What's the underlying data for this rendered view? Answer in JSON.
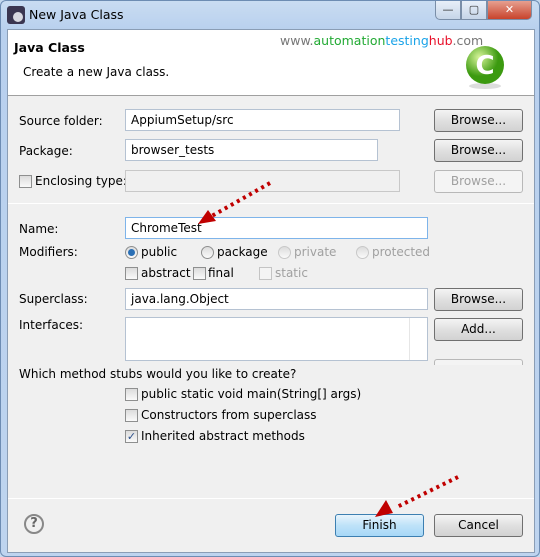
{
  "window": {
    "title": "New Java Class",
    "minimize": "—",
    "maximize": "▢",
    "close": "✕"
  },
  "header": {
    "title": "Java Class",
    "description": "Create a new Java class.",
    "watermark": {
      "www": "www.",
      "a": "automation",
      "b": "testing",
      "c": "hub",
      "d": ".com"
    },
    "logo_letter": "C"
  },
  "form": {
    "source_folder": {
      "label": "Source folder:",
      "value": "AppiumSetup/src",
      "button": "Browse..."
    },
    "package": {
      "label": "Package:",
      "value": "browser_tests",
      "button": "Browse..."
    },
    "enclosing_type": {
      "label": "Enclosing type:",
      "checked": false,
      "value": "",
      "button": "Browse..."
    },
    "name": {
      "label": "Name:",
      "value": "ChromeTest"
    },
    "modifiers": {
      "label": "Modifiers:",
      "options": [
        "public",
        "package",
        "private",
        "protected"
      ],
      "selected": "public",
      "checks": [
        "abstract",
        "final",
        "static"
      ]
    },
    "superclass": {
      "label": "Superclass:",
      "value": "java.lang.Object",
      "button": "Browse..."
    },
    "interfaces": {
      "label": "Interfaces:",
      "add_button": "Add..."
    },
    "stubs": {
      "question": "Which method stubs would you like to create?",
      "items": [
        {
          "label": "public static void main(String[] args)",
          "checked": false
        },
        {
          "label": "Constructors from superclass",
          "checked": false
        },
        {
          "label": "Inherited abstract methods",
          "checked": true
        }
      ]
    }
  },
  "footer": {
    "help": "?",
    "finish": "Finish",
    "cancel": "Cancel"
  },
  "colors": {
    "arrow": "#c00000",
    "watermark_a": "#22aa33",
    "watermark_b": "#1aa3e8",
    "watermark_c": "#e8102a"
  }
}
